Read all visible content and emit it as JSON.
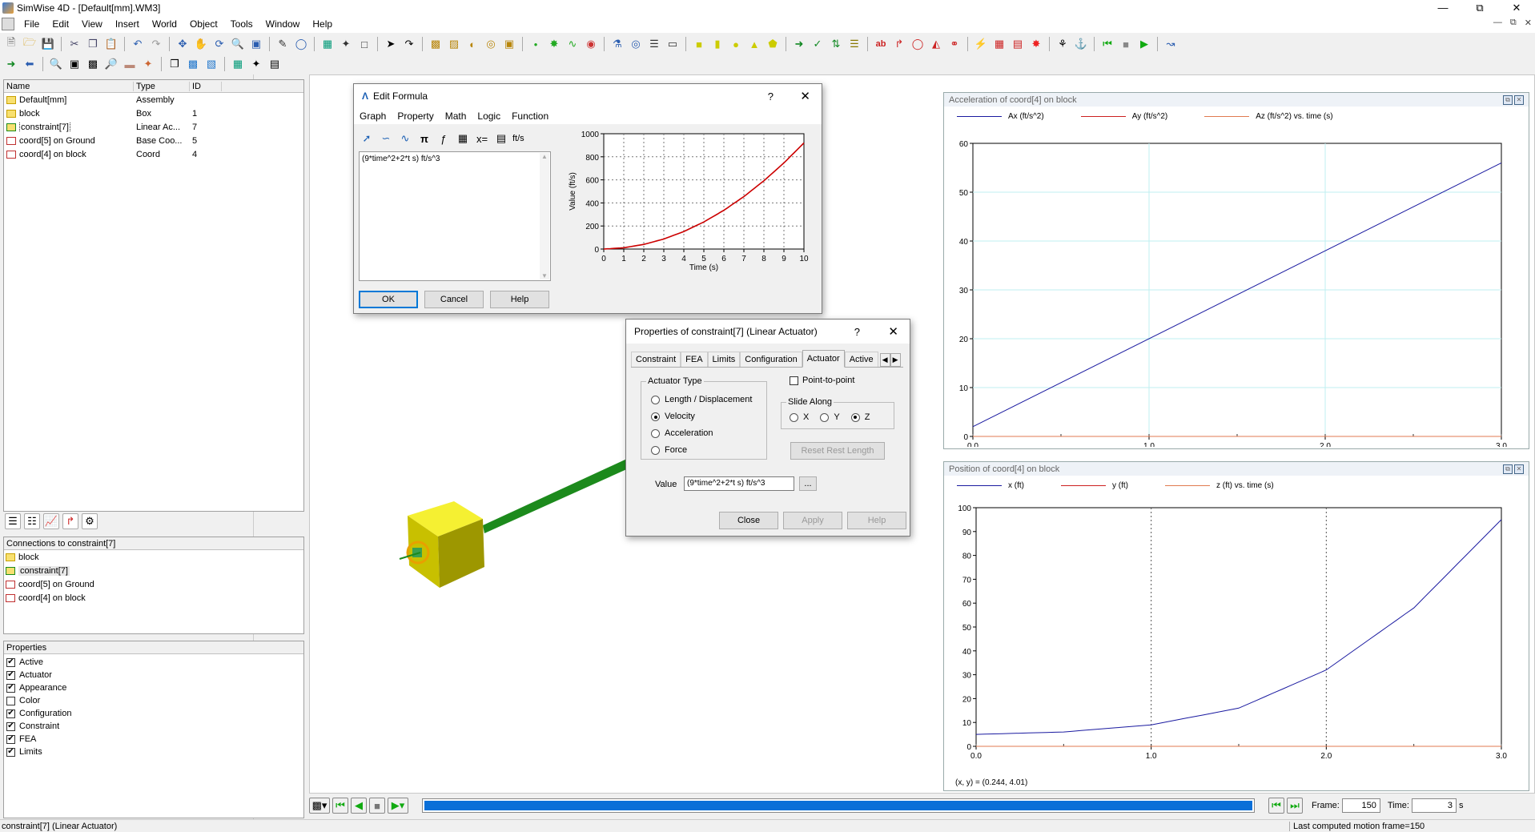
{
  "window": {
    "title": "SimWise 4D - [Default[mm].WM3]"
  },
  "menu": [
    "File",
    "Edit",
    "View",
    "Insert",
    "World",
    "Object",
    "Tools",
    "Window",
    "Help"
  ],
  "tree": {
    "columns": [
      "Name",
      "Type",
      "ID"
    ],
    "rows": [
      {
        "name": "Default[mm]",
        "type": "Assembly",
        "id": "",
        "icon": "assembly-icon"
      },
      {
        "name": "block",
        "type": "Box",
        "id": "1",
        "icon": "box-icon"
      },
      {
        "name": "constraint[7]",
        "type": "Linear Ac...",
        "id": "7",
        "icon": "actuator-icon"
      },
      {
        "name": "coord[5] on Ground",
        "type": "Base Coo...",
        "id": "5",
        "icon": "coord-icon"
      },
      {
        "name": "coord[4] on block",
        "type": "Coord",
        "id": "4",
        "icon": "coord-icon"
      }
    ]
  },
  "connections": {
    "title": "Connections to constraint[7]",
    "items": [
      "block",
      "constraint[7]",
      "coord[5] on Ground",
      "coord[4] on block"
    ]
  },
  "properties": {
    "title": "Properties",
    "items": [
      {
        "label": "Active",
        "checked": true
      },
      {
        "label": "Actuator",
        "checked": true
      },
      {
        "label": "Appearance",
        "checked": true
      },
      {
        "label": "Color",
        "checked": false
      },
      {
        "label": "Configuration",
        "checked": true
      },
      {
        "label": "Constraint",
        "checked": true
      },
      {
        "label": "FEA",
        "checked": true
      },
      {
        "label": "Limits",
        "checked": true
      }
    ]
  },
  "formula": {
    "title": "Edit Formula",
    "help": "?",
    "menu": [
      "Graph",
      "Property",
      "Math",
      "Logic",
      "Function"
    ],
    "unit": "ft/s",
    "text": "(9*time^2+2*t s) ft/s^3",
    "ok": "OK",
    "cancel": "Cancel",
    "helpbtn": "Help",
    "chart_data": {
      "type": "line",
      "xlabel": "Time (s)",
      "ylabel": "Value (ft/s)",
      "xlim": [
        0,
        10
      ],
      "ylim": [
        0,
        1000
      ],
      "xticks": [
        0,
        1,
        2,
        3,
        4,
        5,
        6,
        7,
        8,
        9,
        10
      ],
      "yticks": [
        0,
        200,
        400,
        600,
        800,
        1000
      ],
      "grid": true,
      "series": [
        {
          "color": "#cc0000",
          "x": [
            0,
            1,
            2,
            3,
            4,
            5,
            6,
            7,
            8,
            9,
            10
          ],
          "y": [
            0,
            11,
            40,
            87,
            152,
            235,
            336,
            455,
            592,
            747,
            920
          ]
        }
      ]
    }
  },
  "props_dialog": {
    "title": "Properties of constraint[7] (Linear Actuator)",
    "help": "?",
    "tabs": [
      "Constraint",
      "FEA",
      "Limits",
      "Configuration",
      "Actuator",
      "Active"
    ],
    "active_tab": "Actuator",
    "actuator_type_label": "Actuator Type",
    "types": [
      {
        "label": "Length / Displacement",
        "on": false
      },
      {
        "label": "Velocity",
        "on": true
      },
      {
        "label": "Acceleration",
        "on": false
      },
      {
        "label": "Force",
        "on": false
      }
    ],
    "point_to_point": "Point-to-point",
    "slide_along": "Slide Along",
    "axes": [
      {
        "label": "X",
        "on": false
      },
      {
        "label": "Y",
        "on": false
      },
      {
        "label": "Z",
        "on": true
      }
    ],
    "reset": "Reset Rest Length",
    "value_label": "Value",
    "value": "(9*time^2+2*t s) ft/s^3",
    "browse": "...",
    "close": "Close",
    "apply": "Apply",
    "helpbtn": "Help"
  },
  "accel_graph": {
    "title": "Acceleration of coord[4] on block",
    "legend": [
      "Ax (ft/s^2)",
      "Ay (ft/s^2)",
      "Az (ft/s^2)  vs. time (s)"
    ],
    "chart_data": {
      "type": "line",
      "xlim": [
        0,
        3
      ],
      "ylim": [
        0,
        60
      ],
      "xticks": [
        "0.0",
        "1.0",
        "2.0",
        "3.0"
      ],
      "yticks": [
        0,
        10,
        20,
        30,
        40,
        50,
        60
      ],
      "series": [
        {
          "name": "Ax (ft/s^2)",
          "color": "#1a1aa0",
          "x": [
            0,
            3
          ],
          "y": [
            2,
            56
          ]
        },
        {
          "name": "Ay (ft/s^2)",
          "color": "#cc2020",
          "x": [
            0,
            3
          ],
          "y": [
            0,
            0
          ]
        },
        {
          "name": "Az (ft/s^2)",
          "color": "#e07a50",
          "x": [
            0,
            3
          ],
          "y": [
            0,
            0
          ]
        }
      ]
    }
  },
  "pos_graph": {
    "title": "Position of coord[4] on block",
    "legend": [
      "x (ft)",
      "y (ft)",
      "z (ft)  vs. time (s)"
    ],
    "readout": "(x, y) = (0.244, 4.01)",
    "chart_data": {
      "type": "line",
      "xlim": [
        0,
        3
      ],
      "ylim": [
        0,
        100
      ],
      "xticks": [
        "0.0",
        "1.0",
        "2.0",
        "3.0"
      ],
      "yticks": [
        0,
        10,
        20,
        30,
        40,
        50,
        60,
        70,
        80,
        90,
        100
      ],
      "series": [
        {
          "name": "x (ft)",
          "color": "#1a1aa0",
          "x": [
            0,
            0.5,
            1,
            1.5,
            2,
            2.5,
            3
          ],
          "y": [
            5,
            6,
            9,
            16,
            32,
            58,
            95
          ]
        },
        {
          "name": "y (ft)",
          "color": "#cc2020",
          "x": [
            0,
            3
          ],
          "y": [
            0,
            0
          ]
        },
        {
          "name": "z (ft)",
          "color": "#e07a50",
          "x": [
            0,
            3
          ],
          "y": [
            0,
            0
          ]
        }
      ]
    }
  },
  "playback": {
    "frame_label": "Frame:",
    "frame": "150",
    "time_label": "Time:",
    "time": "3",
    "time_unit": "s",
    "progress": 1.0
  },
  "status": {
    "left": "constraint[7] (Linear Actuator)",
    "right": "Last computed motion frame=150"
  }
}
